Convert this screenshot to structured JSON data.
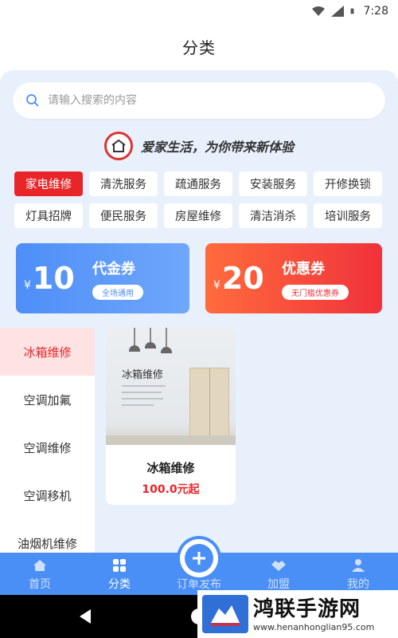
{
  "status_bar": {
    "time": "7:28"
  },
  "header": {
    "title": "分类"
  },
  "search": {
    "placeholder": "请输入搜索的内容"
  },
  "slogan": {
    "text": "爱家生活，为你带来新体验"
  },
  "tags": [
    "家电维修",
    "清洗服务",
    "疏通服务",
    "安装服务",
    "开修换锁",
    "灯具招牌",
    "便民服务",
    "房屋维修",
    "清洁消杀",
    "培训服务"
  ],
  "coupons": [
    {
      "currency": "¥",
      "amount": "10",
      "name": "代金券",
      "badge": "全场通用"
    },
    {
      "currency": "¥",
      "amount": "20",
      "name": "优惠券",
      "badge": "无门槛优惠券"
    }
  ],
  "side_menu": [
    "冰箱维修",
    "空调加氟",
    "空调维修",
    "空调移机",
    "油烟机维修"
  ],
  "product": {
    "image_title": "冰箱维修",
    "name": "冰箱维修",
    "price": "100.0元起"
  },
  "tabbar": [
    {
      "label": "首页",
      "icon": "home-icon"
    },
    {
      "label": "分类",
      "icon": "grid-icon"
    },
    {
      "label": "订单发布",
      "icon": "plus-icon"
    },
    {
      "label": "加盟",
      "icon": "handshake-icon"
    },
    {
      "label": "我的",
      "icon": "user-icon"
    }
  ],
  "watermark": {
    "title": "鸿联手游网",
    "url": "www.henanhonglian95.com"
  },
  "colors": {
    "accent_blue": "#4a8ff5",
    "accent_red": "#e8262a",
    "content_bg": "#e7f0fb"
  }
}
